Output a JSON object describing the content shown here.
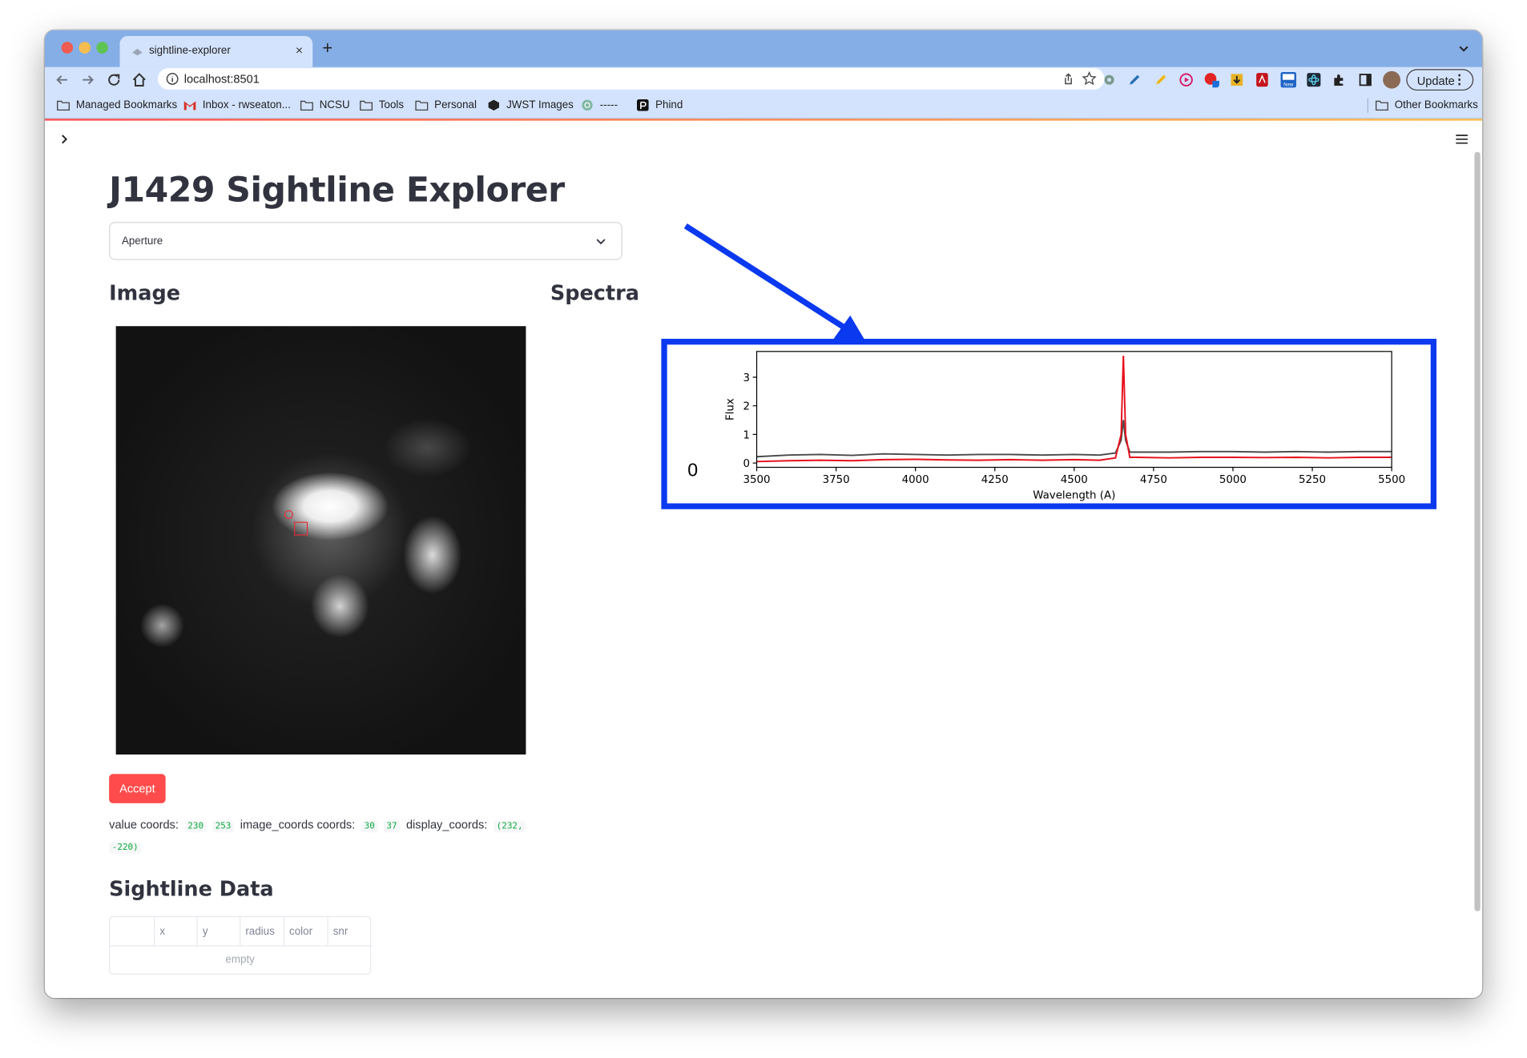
{
  "browser": {
    "tab_title": "sightline-explorer",
    "tab_close": "×",
    "new_tab": "+",
    "url": "localhost:8501",
    "update_label": "Update",
    "update_menu": "⋮",
    "bookmarks": [
      {
        "label": "Managed Bookmarks",
        "icon": "folder-icon"
      },
      {
        "label": "Inbox - rwseaton...",
        "icon": "gmail-icon"
      },
      {
        "label": "NCSU",
        "icon": "folder-icon"
      },
      {
        "label": "Tools",
        "icon": "folder-icon"
      },
      {
        "label": "Personal",
        "icon": "folder-icon"
      },
      {
        "label": "JWST Images",
        "icon": "hexagon-icon"
      },
      {
        "label": "-----",
        "icon": "openai-icon"
      },
      {
        "label": "Phind",
        "icon": "phind-icon"
      }
    ],
    "other_bookmarks": "Other Bookmarks"
  },
  "app": {
    "title": "J1429 Sightline Explorer",
    "select": {
      "value": "Aperture"
    },
    "image_heading": "Image",
    "spectra_heading": "Spectra",
    "accept_label": "Accept",
    "coords": {
      "value_label": "value coords:",
      "value_x": "230",
      "value_y": "253",
      "image_label": "image_coords coords:",
      "image_x": "30",
      "image_y": "37",
      "display_label": "display_coords:",
      "display_part1": "(232,",
      "display_part2": "-220)"
    },
    "sightline_heading": "Sightline Data",
    "table": {
      "columns": [
        "",
        "x",
        "y",
        "radius",
        "color",
        "snr"
      ],
      "empty_text": "empty"
    },
    "spectra_zero": "0"
  },
  "colors": {
    "accent": "#ff4b4b",
    "annotation": "#0b39f0",
    "series_red": "#e8101c",
    "series_gray": "#4a4a4a"
  },
  "chart_data": {
    "type": "line",
    "title": "",
    "xlabel": "Wavelength (A)",
    "ylabel": "Flux",
    "xlim": [
      3500,
      5500
    ],
    "ylim": [
      -0.15,
      3.9
    ],
    "xticks": [
      3500,
      3750,
      4000,
      4250,
      4500,
      4750,
      5000,
      5250,
      5500
    ],
    "yticks": [
      0,
      1,
      2,
      3
    ],
    "grid": false,
    "series": [
      {
        "color": "#e8101c",
        "x": [
          3500,
          3600,
          3700,
          3800,
          3900,
          4000,
          4100,
          4200,
          4300,
          4400,
          4500,
          4580,
          4630,
          4648,
          4655,
          4662,
          4675,
          4700,
          4800,
          4900,
          5000,
          5100,
          5200,
          5300,
          5400,
          5500
        ],
        "y": [
          0.05,
          0.08,
          0.1,
          0.08,
          0.12,
          0.13,
          0.11,
          0.1,
          0.12,
          0.1,
          0.12,
          0.1,
          0.18,
          1.0,
          3.75,
          1.0,
          0.2,
          0.2,
          0.18,
          0.2,
          0.2,
          0.19,
          0.2,
          0.18,
          0.2,
          0.2
        ]
      },
      {
        "color": "#4a4a4a",
        "x": [
          3500,
          3600,
          3700,
          3800,
          3900,
          4000,
          4100,
          4200,
          4300,
          4400,
          4500,
          4580,
          4630,
          4648,
          4655,
          4662,
          4675,
          4700,
          4800,
          4900,
          5000,
          5100,
          5200,
          5300,
          5400,
          5500
        ],
        "y": [
          0.22,
          0.28,
          0.3,
          0.27,
          0.32,
          0.3,
          0.28,
          0.3,
          0.3,
          0.28,
          0.3,
          0.28,
          0.35,
          0.8,
          1.5,
          0.8,
          0.38,
          0.38,
          0.38,
          0.4,
          0.4,
          0.38,
          0.4,
          0.38,
          0.4,
          0.4
        ]
      }
    ]
  }
}
